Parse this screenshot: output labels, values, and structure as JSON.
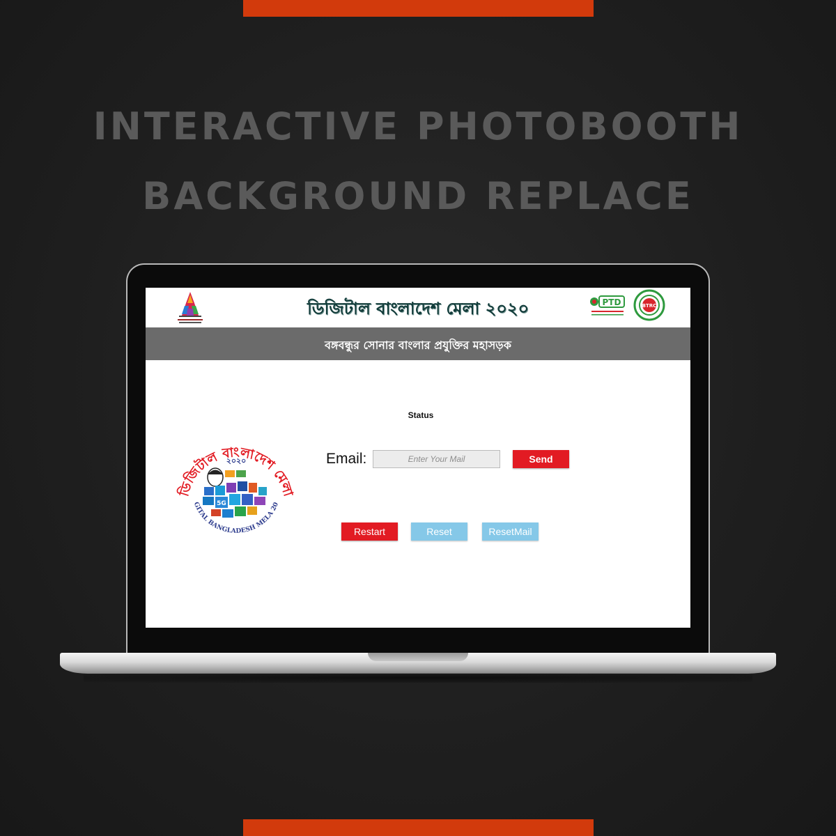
{
  "promo": {
    "headline_line1": "INTERACTIVE PHOTOBOOTH",
    "headline_line2": "BACKGROUND REPLACE",
    "accent_color": "#d23a0c"
  },
  "app": {
    "title": "ডিজিটাল বাংলাদেশ মেলা ২০২০",
    "subtitle": "বঙ্গবন্ধুর সোনার বাংলার প্রযুক্তির মহাসড়ক",
    "logos": {
      "ptd": "PTD",
      "btrc": "BTRC",
      "fair_arc_text": "ডিজিটাল বাংলাদেশ মেলা",
      "fair_year": "২০২০",
      "fair_bottom_text": "DIGITAL BANGLADESH MELA 2020"
    },
    "status_label": "Status",
    "email": {
      "label": "Email:",
      "placeholder": "Enter Your Mail",
      "value": ""
    },
    "buttons": {
      "send": "Send",
      "restart": "Restart",
      "reset": "Reset",
      "reset_mail": "ResetMail"
    },
    "colors": {
      "primary_red": "#e21b23",
      "secondary_blue": "#85c8e8",
      "subheader_gray": "#6b6b6b",
      "title_teal": "#123c3a"
    }
  }
}
